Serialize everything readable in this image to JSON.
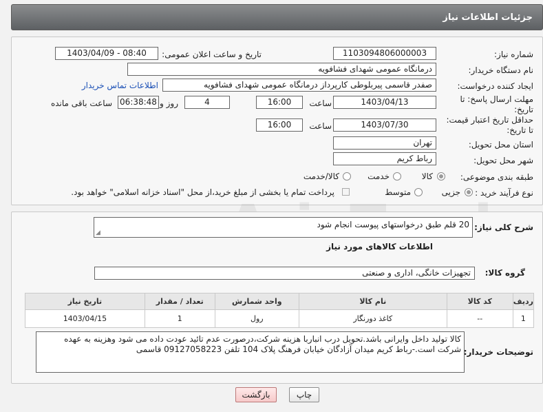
{
  "header_title": "جزئیات اطلاعات نیاز",
  "fields": {
    "need_number_label": "شماره نیاز:",
    "need_number": "1103094806000003",
    "announce_label": "تاریخ و ساعت اعلان عمومی:",
    "announce_value": "1403/04/09 - 08:40",
    "buyer_org_label": "نام دستگاه خریدار:",
    "buyer_org": "درمانگاه عمومی شهدای فشافویه",
    "creator_label": "ایجاد کننده درخواست:",
    "creator": "صفدر قاسمی پیربلوطی کارپرداز درمانگاه عمومی شهدای فشافویه",
    "contact_link": "اطلاعات تماس خریدار",
    "reply_deadline_label": "مهلت ارسال پاسخ: تا تاریخ:",
    "reply_date": "1403/04/13",
    "time_label": "ساعت",
    "reply_time": "16:00",
    "days": "4",
    "days_label": "روز و",
    "remaining": "06:38:48",
    "remaining_label": "ساعت باقی مانده",
    "validity_label": "حداقل تاریخ اعتبار قیمت: تا تاریخ:",
    "validity_date": "1403/07/30",
    "validity_time": "16:00",
    "province_label": "استان محل تحویل:",
    "province": "تهران",
    "city_label": "شهر محل تحویل:",
    "city": "رباط کریم",
    "category_label": "طبقه بندی موضوعی:",
    "category_options": [
      "کالا",
      "خدمت",
      "کالا/خدمت"
    ],
    "category_selected": "کالا",
    "process_label": "نوع فرآیند خرید :",
    "process_options": [
      "جزیی",
      "متوسط"
    ],
    "process_selected": "جزیی",
    "payment_note": "پرداخت تمام یا بخشی از مبلغ خرید،از محل \"اسناد خزانه اسلامی\" خواهد بود."
  },
  "description": {
    "label": "شرح کلی نیاز:",
    "value": "20 قلم طبق درخواستهای پیوست انجام شود"
  },
  "goods": {
    "section_title": "اطلاعات کالاهای مورد نیاز",
    "group_label": "گروه کالا:",
    "group_value": "تجهیزات خانگی، اداری و صنعتی",
    "table": {
      "headers": [
        "ردیف",
        "کد کالا",
        "نام کالا",
        "واحد شمارش",
        "تعداد / مقدار",
        "تاریخ نیاز"
      ],
      "rows": [
        [
          "1",
          "--",
          "کاغذ دورنگار",
          "رول",
          "1",
          "1403/04/15"
        ]
      ]
    }
  },
  "buyer_notes": {
    "label": "توضیحات خریدار:",
    "value": "کالا تولید داخل وایرانی باشد.تحویل درب انباربا هزینه شرکت،درصورت عدم تائید عودت داده می شود وهزینه به عهده شرکت است.-رباط کریم میدان آزادگان خیابان فرهنگ پلاک 104 تلفن 09127058223 قاسمی"
  },
  "buttons": {
    "print": "چاپ",
    "back": "بازگشت"
  },
  "watermark_text": "AriaTender.net",
  "colors": {
    "header_bg": "#6f7275",
    "link": "#1a4fb5",
    "back_button": "#f6c9c9"
  }
}
